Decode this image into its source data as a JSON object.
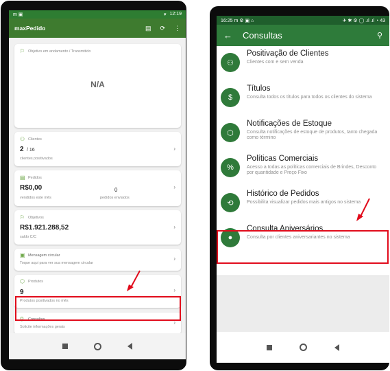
{
  "left": {
    "status": {
      "left_icons": "m ▣",
      "right": "12:19",
      "signal": "▾"
    },
    "appbar": {
      "title": "maxPedido",
      "act1": "▤",
      "act2": "⟳",
      "act3": "⋮"
    },
    "objective_card": {
      "label": "Objetivo em andamento / Transmitido",
      "value": "N/A"
    },
    "clientes_card": {
      "label": "Clientes",
      "value_main": "2",
      "value_sep": "/ 16",
      "caption": "clientes positivados"
    },
    "pedidos_card": {
      "label": "Pedidos",
      "value": "R$0,00",
      "caption": "vendidos este mês",
      "count": "0",
      "count_caption": "pedidos enviados"
    },
    "objetivos_card": {
      "label": "Objetivos",
      "value": "R$1.921.288,52",
      "caption": "saldo C/C"
    },
    "mensagem_card": {
      "label": "Mensagem circular",
      "caption": "Toque aqui para ver sua mensagem circular"
    },
    "produtos_card": {
      "label": "Produtos",
      "value": "9",
      "caption": "Produtos positivados no mês"
    },
    "consultas_card": {
      "label": "Consultas",
      "caption": "Solicite informações gerais"
    }
  },
  "right": {
    "status": {
      "time": "16:25",
      "icons": "m ⚙ ▣ ⌂",
      "right_icons": "✈ ✱ ⚙ ◯ .ıl .ıl ◔ 43"
    },
    "appbar": {
      "title": "Consultas"
    },
    "items": [
      {
        "title": "Positivação de Clientes",
        "desc": "Clientes com e sem venda",
        "icon": "users-icon"
      },
      {
        "title": "Títulos",
        "desc": "Consulta todos os títulos para todos os clientes do sistema",
        "icon": "money-icon"
      },
      {
        "title": "Notificações de Estoque",
        "desc": "Consulta notificações de estoque de produtos, tanto chegada como término",
        "icon": "box-icon"
      },
      {
        "title": "Políticas Comerciais",
        "desc": "Acesso a todas as políticas comerciais de Brindes, Desconto por quantidade e Preço Fixo",
        "icon": "percent-icon"
      },
      {
        "title": "Histórico de Pedidos",
        "desc": "Possibilita visualizar pedidos mais antigos no sistema",
        "icon": "history-icon"
      },
      {
        "title": "Consulta Aniversários",
        "desc": "Consulta por clientes aniversariantes no sistema",
        "icon": "balloon-icon"
      }
    ]
  },
  "colors": {
    "primary_green": "#2e7b3a",
    "highlight_red": "#e10b1b"
  }
}
